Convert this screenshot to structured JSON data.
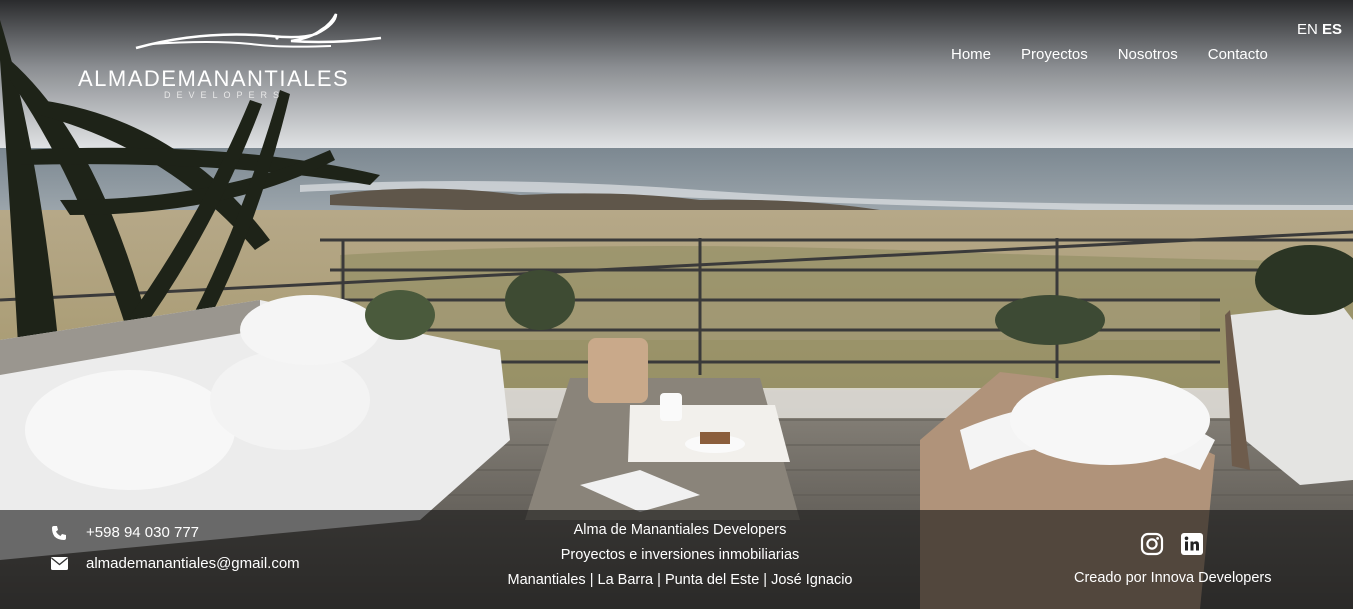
{
  "brand": {
    "name": "ALMADEMANANTIALES",
    "sub": "DEVELOPERS"
  },
  "lang": {
    "en": "EN",
    "es": "ES"
  },
  "nav": {
    "items": [
      {
        "label": "Home"
      },
      {
        "label": "Proyectos"
      },
      {
        "label": "Nosotros"
      },
      {
        "label": "Contacto"
      }
    ]
  },
  "footer": {
    "phone": "+598 94 030 777",
    "email": "almademanantiales@gmail.com",
    "lines": [
      "Alma de Manantiales Developers",
      "Proyectos e inversiones inmobiliarias",
      "Manantiales | La Barra | Punta del Este | José Ignacio"
    ],
    "credit": "Creado por Innova Developers",
    "icons": [
      "phone-icon",
      "envelope-icon",
      "instagram-icon",
      "linkedin-icon"
    ]
  },
  "colors": {
    "sky": "#d9dcdf",
    "sea": "#8e9aa3",
    "sand": "#b9ab8e",
    "deck": "#6e6a63",
    "footer_overlay": "#191919"
  }
}
